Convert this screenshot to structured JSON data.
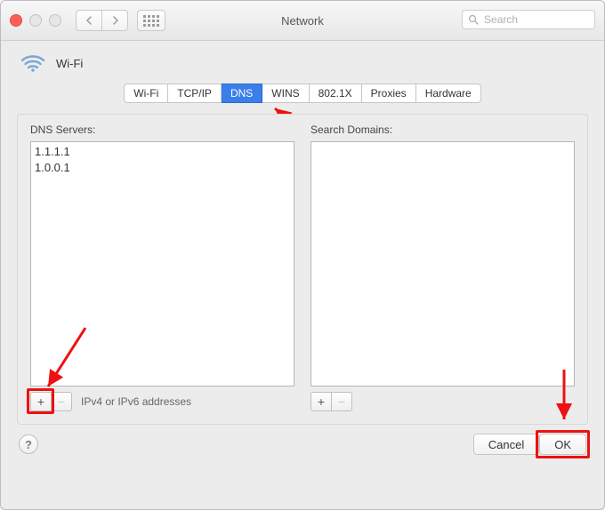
{
  "window": {
    "title": "Network"
  },
  "toolbar": {
    "search_placeholder": "Search"
  },
  "header": {
    "interface": "Wi-Fi"
  },
  "tabs": [
    {
      "id": "wifi",
      "label": "Wi-Fi"
    },
    {
      "id": "tcpip",
      "label": "TCP/IP"
    },
    {
      "id": "dns",
      "label": "DNS",
      "active": true
    },
    {
      "id": "wins",
      "label": "WINS"
    },
    {
      "id": "8021x",
      "label": "802.1X"
    },
    {
      "id": "proxies",
      "label": "Proxies"
    },
    {
      "id": "hardware",
      "label": "Hardware"
    }
  ],
  "dns": {
    "servers_label": "DNS Servers:",
    "servers": [
      "1.1.1.1",
      "1.0.0.1"
    ],
    "servers_hint": "IPv4 or IPv6 addresses",
    "domains_label": "Search Domains:",
    "domains": []
  },
  "buttons": {
    "cancel": "Cancel",
    "ok": "OK",
    "plus": "+",
    "minus": "−"
  },
  "help": "?"
}
